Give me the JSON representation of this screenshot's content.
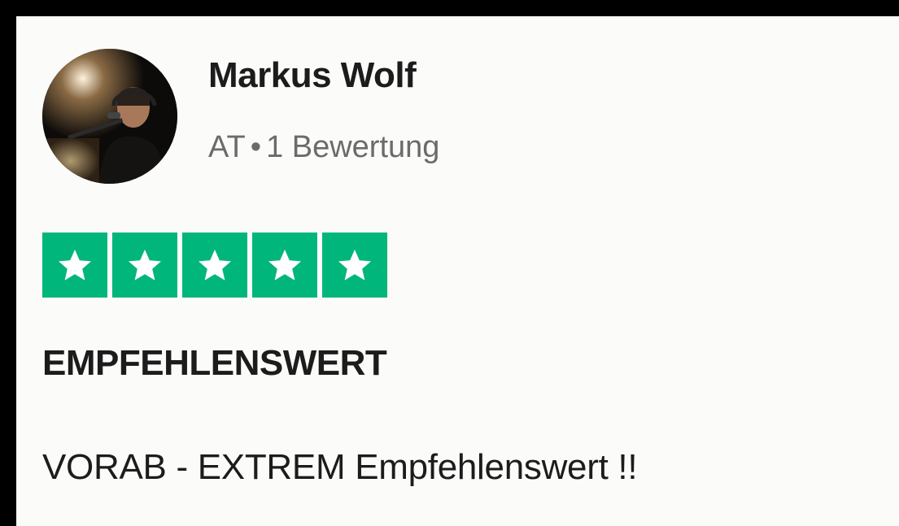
{
  "reviewer": {
    "name": "Markus Wolf",
    "country": "AT",
    "separator": "•",
    "review_count": "1 Bewertung",
    "avatar_icon": "user-photo-avatar"
  },
  "rating": {
    "value": 5,
    "max": 5,
    "star_color": "#00b67a",
    "icon": "star-icon"
  },
  "review": {
    "title": "EMPFEHLENSWERT",
    "body": "VORAB - EXTREM Empfehlenswert !!"
  }
}
